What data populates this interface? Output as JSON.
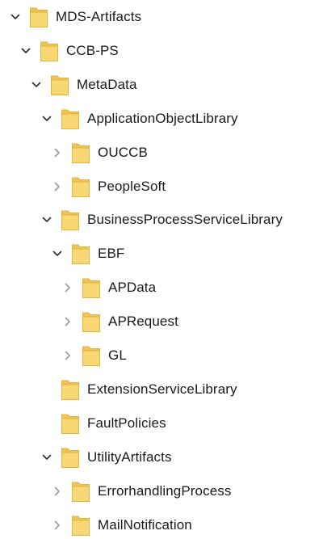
{
  "tree": {
    "rows": [
      {
        "label": "MDS-Artifacts",
        "depth": 0,
        "state": "expanded"
      },
      {
        "label": "CCB-PS",
        "depth": 1,
        "state": "expanded"
      },
      {
        "label": "MetaData",
        "depth": 2,
        "state": "expanded"
      },
      {
        "label": "ApplicationObjectLibrary",
        "depth": 3,
        "state": "expanded"
      },
      {
        "label": "OUCCB",
        "depth": 4,
        "state": "collapsed"
      },
      {
        "label": "PeopleSoft",
        "depth": 4,
        "state": "collapsed"
      },
      {
        "label": "BusinessProcessServiceLibrary",
        "depth": 3,
        "state": "expanded"
      },
      {
        "label": "EBF",
        "depth": 4,
        "state": "expanded"
      },
      {
        "label": "APData",
        "depth": 5,
        "state": "collapsed"
      },
      {
        "label": "APRequest",
        "depth": 5,
        "state": "collapsed"
      },
      {
        "label": "GL",
        "depth": 5,
        "state": "collapsed"
      },
      {
        "label": "ExtensionServiceLibrary",
        "depth": 3,
        "state": "leaf"
      },
      {
        "label": "FaultPolicies",
        "depth": 3,
        "state": "leaf"
      },
      {
        "label": "UtilityArtifacts",
        "depth": 3,
        "state": "expanded"
      },
      {
        "label": "ErrorhandlingProcess",
        "depth": 4,
        "state": "collapsed"
      },
      {
        "label": "MailNotification",
        "depth": 4,
        "state": "collapsed"
      }
    ]
  },
  "icons": {
    "folder": "folder-icon",
    "expanded": "chevron-down-icon",
    "collapsed": "chevron-right-icon"
  },
  "colors": {
    "folder_fill": "#F8D775",
    "folder_stroke": "#E2B43C",
    "chevron_expanded": "#2b2b2b",
    "chevron_collapsed": "#9a9a9a",
    "text": "#1a1a1a"
  }
}
